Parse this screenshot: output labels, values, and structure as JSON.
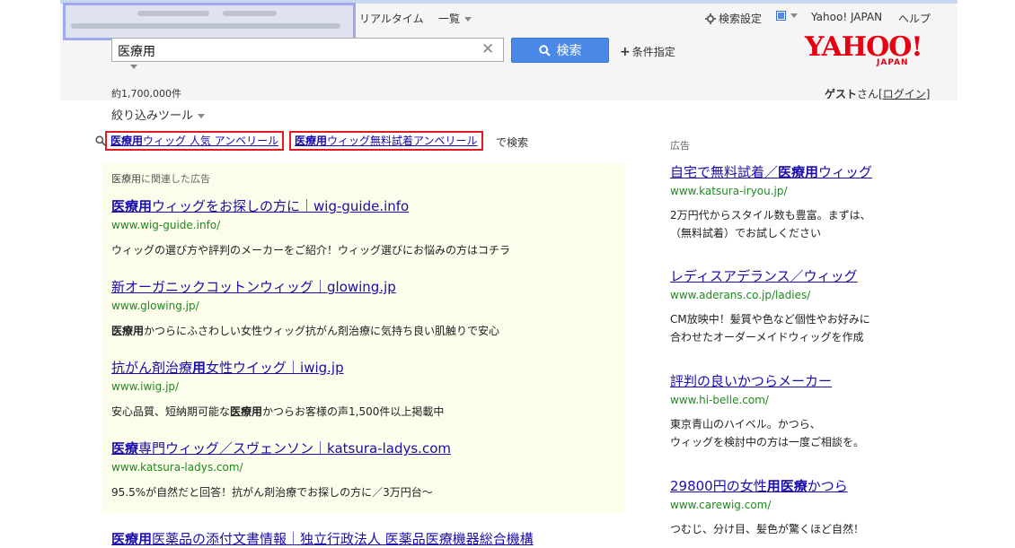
{
  "header": {
    "tabs": [
      "リアルタイム",
      "一覧"
    ],
    "settings_label": "検索設定",
    "yahoo_japan_link": "Yahoo! JAPAN",
    "help_link": "ヘルプ",
    "logo_text": "YAHOO!",
    "logo_sub": "JAPAN"
  },
  "search": {
    "query": "医療用",
    "button_label": "検索",
    "conditions_label": "条件指定",
    "clear_symbol": "✕"
  },
  "summary": {
    "result_count": "約1,700,000件",
    "guest_name": "ゲスト",
    "guest_suffix": "さん",
    "login_label": "ログイン",
    "bracket_open": "[",
    "bracket_close": "]"
  },
  "filter": {
    "label": "絞り込みツール"
  },
  "suggestions": {
    "items": [
      {
        "bold": "医療用",
        "rest": "ウィッグ 人気 アンベリール"
      },
      {
        "bold": "医療用",
        "rest": "ウィッグ無料試着アンベリール"
      }
    ],
    "suffix": "で検索"
  },
  "main_ads": {
    "label_bold": "医療用",
    "label_rest": "に関連した広告",
    "items": [
      {
        "title_bold": "医療用",
        "title_rest": "ウィッグをお探しの方に｜wig-guide.info",
        "url": "www.wig-guide.info/",
        "desc_bold": "",
        "desc_rest": "ウィッグの選び方や評判のメーカーをご紹介！ウィッグ選びにお悩みの方はコチラ"
      },
      {
        "title_bold": "",
        "title_rest": "新オーガニックコットンウィッグ｜glowing.jp",
        "url": "www.glowing.jp/",
        "desc_bold": "医療用",
        "desc_rest": "かつらにふさわしい女性ウィッグ抗がん剤治療に気持ち良い肌触りで安心"
      },
      {
        "title_pre": "抗がん剤治療",
        "title_bold": "用",
        "title_rest": "女性ウイッグ｜iwig.jp",
        "url": "www.iwig.jp/",
        "desc_pre": "安心品質、短納期可能な",
        "desc_bold": "医療用",
        "desc_rest": "かつらお客様の声1,500件以上掲載中"
      },
      {
        "title_bold": "医療",
        "title_rest": "専門ウィッグ／スヴェンソン｜katsura-ladys.com",
        "url": "www.katsura-ladys.com/",
        "desc_bold": "",
        "desc_rest": "95.5%が自然だと回答！抗がん剤治療でお探しの方に／3万円台〜"
      }
    ],
    "cut_off_title_bold": "医療用",
    "cut_off_title_rest": "医薬品の添付文書情報｜独立行政法人 医薬品医療機器総合機構"
  },
  "side_ads": {
    "label": "広告",
    "items": [
      {
        "title_pre": "自宅で無料試着／",
        "title_bold": "医療用",
        "title_rest": "ウィッグ",
        "url": "www.katsura-iryou.jp/",
        "desc": [
          "2万円代からスタイル数も豊富。まずは、",
          "（無料試着）でお試しください"
        ]
      },
      {
        "title_pre": "レディスアデランス／ウィッグ",
        "title_bold": "",
        "title_rest": "",
        "url": "www.aderans.co.jp/ladies/",
        "desc": [
          "CM放映中！髪質や色など個性やお好みに",
          "合わせたオーダーメイドウィッグを作成"
        ]
      },
      {
        "title_pre": "評判の良いかつらメーカー",
        "title_bold": "",
        "title_rest": "",
        "url": "www.hi-belle.com/",
        "desc": [
          "東京青山のハイベル。かつら、",
          "ウィッグを検討中の方は一度ご相談を。"
        ]
      },
      {
        "title_pre": "29800円の女性",
        "title_bold": "用医療",
        "title_rest": "かつら",
        "url": "www.carewig.com/",
        "desc": [
          "つむじ、分け目、髪色が驚くほど自然！"
        ]
      }
    ]
  },
  "colors": {
    "accent": "#4a89e8",
    "link": "#1a0dab",
    "url_green": "#1e8a1e",
    "logo_red": "#e60012",
    "highlight_border": "#e2191f",
    "ad_bg": "#fdfdec"
  }
}
